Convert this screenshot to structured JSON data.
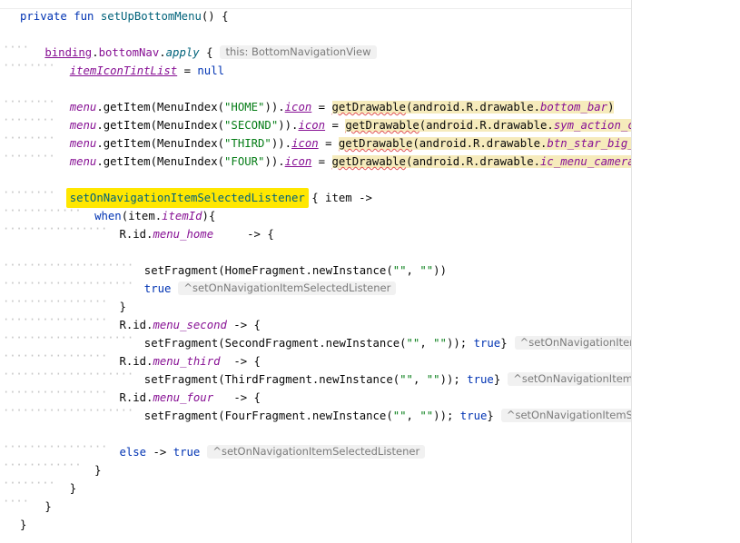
{
  "editor": {
    "lines": [
      {
        "indent": "",
        "code": [
          {
            "t": "private fun ",
            "c": "kw"
          },
          {
            "t": "setUpBottomMenu",
            "c": "fn"
          },
          {
            "t": "() {",
            "c": ""
          }
        ]
      },
      {
        "indent": "",
        "code": []
      },
      {
        "indent": "····",
        "code": [
          {
            "t": "binding",
            "c": "prop ul"
          },
          {
            "t": ".",
            "c": ""
          },
          {
            "t": "bottomNav",
            "c": "prop"
          },
          {
            "t": ".",
            "c": ""
          },
          {
            "t": "apply",
            "c": "fn it"
          },
          {
            "t": " {",
            "c": ""
          }
        ],
        "hint": "this: BottomNavigationView"
      },
      {
        "indent": "········",
        "code": [
          {
            "t": "itemIconTintList",
            "c": "prop it ul"
          },
          {
            "t": " = ",
            "c": ""
          },
          {
            "t": "null",
            "c": "kw"
          }
        ]
      },
      {
        "indent": "",
        "code": []
      },
      {
        "indent": "········",
        "code": [
          {
            "t": "menu",
            "c": "prop it"
          },
          {
            "t": ".getItem(MenuIndex(",
            "c": ""
          },
          {
            "t": "\"HOME\"",
            "c": "str"
          },
          {
            "t": ")).",
            "c": ""
          },
          {
            "t": "icon",
            "c": "prop it ul"
          },
          {
            "t": " = ",
            "c": ""
          },
          {
            "t": "getDrawable",
            "c": "hl squig"
          },
          {
            "t": "(android.R.drawable.",
            "c": "hl"
          },
          {
            "t": "bottom_bar",
            "c": "hl prop it"
          },
          {
            "t": ")",
            "c": "hl"
          }
        ]
      },
      {
        "indent": "········",
        "code": [
          {
            "t": "menu",
            "c": "prop it"
          },
          {
            "t": ".getItem(MenuIndex(",
            "c": ""
          },
          {
            "t": "\"SECOND\"",
            "c": "str"
          },
          {
            "t": ")).",
            "c": ""
          },
          {
            "t": "icon",
            "c": "prop it ul"
          },
          {
            "t": " = ",
            "c": ""
          },
          {
            "t": "getDrawable",
            "c": "hl squig"
          },
          {
            "t": "(android.R.drawable.",
            "c": "hl"
          },
          {
            "t": "sym_action_call",
            "c": "hl prop it"
          },
          {
            "t": ")",
            "c": "hl"
          }
        ]
      },
      {
        "indent": "········",
        "code": [
          {
            "t": "menu",
            "c": "prop it"
          },
          {
            "t": ".getItem(MenuIndex(",
            "c": ""
          },
          {
            "t": "\"THIRD\"",
            "c": "str"
          },
          {
            "t": ")).",
            "c": ""
          },
          {
            "t": "icon",
            "c": "prop it ul"
          },
          {
            "t": " = ",
            "c": ""
          },
          {
            "t": "getDrawable",
            "c": "hl squig"
          },
          {
            "t": "(android.R.drawable.",
            "c": "hl"
          },
          {
            "t": "btn_star_big_on",
            "c": "hl prop it"
          },
          {
            "t": ")",
            "c": "hl"
          }
        ]
      },
      {
        "indent": "········",
        "code": [
          {
            "t": "menu",
            "c": "prop it"
          },
          {
            "t": ".getItem(MenuIndex(",
            "c": ""
          },
          {
            "t": "\"FOUR\"",
            "c": "str"
          },
          {
            "t": ")).",
            "c": ""
          },
          {
            "t": "icon",
            "c": "prop it ul"
          },
          {
            "t": " = ",
            "c": ""
          },
          {
            "t": "getDrawable",
            "c": "hl squig"
          },
          {
            "t": "(android.R.drawable.",
            "c": "hl"
          },
          {
            "t": "ic_menu_camera",
            "c": "hl prop it"
          },
          {
            "t": ")",
            "c": "hl"
          }
        ]
      },
      {
        "indent": "",
        "code": []
      },
      {
        "indent": "········",
        "code": [
          {
            "t": "setOnNavigationItemSelectedListener",
            "c": "fn yellow"
          },
          {
            "t": " { item ->",
            "c": ""
          }
        ]
      },
      {
        "indent": "············",
        "code": [
          {
            "t": "when",
            "c": "kw"
          },
          {
            "t": "(item.",
            "c": ""
          },
          {
            "t": "itemId",
            "c": "prop it"
          },
          {
            "t": "){",
            "c": ""
          }
        ]
      },
      {
        "indent": "················",
        "code": [
          {
            "t": "R.id.",
            "c": ""
          },
          {
            "t": "menu_home",
            "c": "prop it"
          },
          {
            "t": "     -> {",
            "c": ""
          }
        ]
      },
      {
        "indent": "",
        "code": []
      },
      {
        "indent": "····················",
        "code": [
          {
            "t": "setFragment(HomeFragment.newInstance(",
            "c": ""
          },
          {
            "t": "\"\"",
            "c": "str"
          },
          {
            "t": ", ",
            "c": ""
          },
          {
            "t": "\"\"",
            "c": "str"
          },
          {
            "t": "))",
            "c": ""
          }
        ]
      },
      {
        "indent": "····················",
        "code": [
          {
            "t": "true",
            "c": "kw"
          }
        ],
        "hint": "^setOnNavigationItemSelectedListener"
      },
      {
        "indent": "················",
        "code": [
          {
            "t": "}",
            "c": ""
          }
        ]
      },
      {
        "indent": "················",
        "code": [
          {
            "t": "R.id.",
            "c": ""
          },
          {
            "t": "menu_second",
            "c": "prop it"
          },
          {
            "t": " -> {",
            "c": ""
          }
        ]
      },
      {
        "indent": "····················",
        "code": [
          {
            "t": "setFragment(SecondFragment.newInstance(",
            "c": ""
          },
          {
            "t": "\"\"",
            "c": "str"
          },
          {
            "t": ", ",
            "c": ""
          },
          {
            "t": "\"\"",
            "c": "str"
          },
          {
            "t": ")); ",
            "c": ""
          },
          {
            "t": "true",
            "c": "kw"
          },
          {
            "t": "}",
            "c": ""
          }
        ],
        "hint": "^setOnNavigationItemSelectedListener"
      },
      {
        "indent": "················",
        "code": [
          {
            "t": "R.id.",
            "c": ""
          },
          {
            "t": "menu_third",
            "c": "prop it"
          },
          {
            "t": "  -> {",
            "c": ""
          }
        ]
      },
      {
        "indent": "····················",
        "code": [
          {
            "t": "setFragment(ThirdFragment.newInstance(",
            "c": ""
          },
          {
            "t": "\"\"",
            "c": "str"
          },
          {
            "t": ", ",
            "c": ""
          },
          {
            "t": "\"\"",
            "c": "str"
          },
          {
            "t": ")); ",
            "c": ""
          },
          {
            "t": "true",
            "c": "kw"
          },
          {
            "t": "}",
            "c": ""
          }
        ],
        "hint": "^setOnNavigationItemSelectedListener"
      },
      {
        "indent": "················",
        "code": [
          {
            "t": "R.id.",
            "c": ""
          },
          {
            "t": "menu_four",
            "c": "prop it"
          },
          {
            "t": "   -> {",
            "c": ""
          }
        ]
      },
      {
        "indent": "····················",
        "code": [
          {
            "t": "setFragment(FourFragment.newInstance(",
            "c": ""
          },
          {
            "t": "\"\"",
            "c": "str"
          },
          {
            "t": ", ",
            "c": ""
          },
          {
            "t": "\"\"",
            "c": "str"
          },
          {
            "t": ")); ",
            "c": ""
          },
          {
            "t": "true",
            "c": "kw"
          },
          {
            "t": "}",
            "c": ""
          }
        ],
        "hint": "^setOnNavigationItemSelectedListener"
      },
      {
        "indent": "",
        "code": []
      },
      {
        "indent": "················",
        "code": [
          {
            "t": "else",
            "c": "kw"
          },
          {
            "t": " -> ",
            "c": ""
          },
          {
            "t": "true",
            "c": "kw"
          }
        ],
        "hint": "^setOnNavigationItemSelectedListener"
      },
      {
        "indent": "············",
        "code": [
          {
            "t": "}",
            "c": ""
          }
        ]
      },
      {
        "indent": "········",
        "code": [
          {
            "t": "}",
            "c": ""
          }
        ]
      },
      {
        "indent": "····",
        "code": [
          {
            "t": "}",
            "c": ""
          }
        ]
      },
      {
        "indent": "",
        "code": [
          {
            "t": "}",
            "c": ""
          }
        ]
      }
    ]
  },
  "colors": {
    "keyword": "#0033b3",
    "function": "#00627a",
    "property": "#871094",
    "string": "#067d17",
    "line_highlight": "#f6ebbc",
    "search_highlight": "#ffe700",
    "hint_background": "#f1f1f1"
  }
}
